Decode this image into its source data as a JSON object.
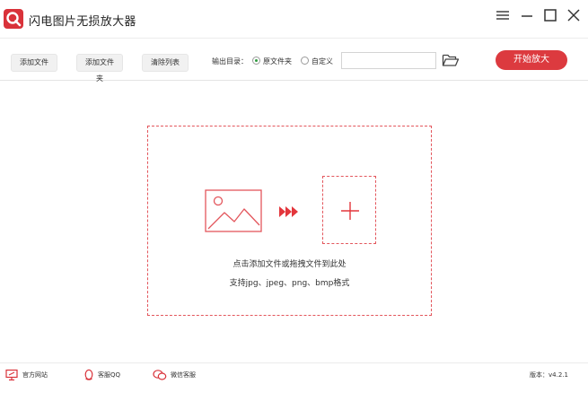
{
  "app": {
    "title": "闪电图片无损放大器"
  },
  "toolbar": {
    "add_file": "添加文件",
    "add_folder": "添加文件夹",
    "clear_list": "清除列表",
    "output_label": "输出目录：",
    "option_source": "原文件夹",
    "option_custom": "自定义",
    "selected_option": "原文件夹",
    "path_value": "",
    "start": "开始放大"
  },
  "drop": {
    "hint": "点击添加文件或拖拽文件到此处",
    "formats": "支持jpg、jpeg、png、bmp格式"
  },
  "footer": {
    "website": "官方网站",
    "qq": "客服QQ",
    "wechat": "微信客服",
    "version": "版本：v4.2.1"
  },
  "colors": {
    "accent": "#dc3a3f",
    "dashed": "#e3565c",
    "radio_checked": "#2f9a3f"
  },
  "icons": {
    "logo": "app-logo-icon",
    "menu": "menu-icon",
    "minimize": "minimize-icon",
    "maximize": "maximize-icon",
    "close": "close-icon",
    "folder": "folder-open-icon",
    "image": "image-icon",
    "arrows": "triple-arrow-icon",
    "add": "plus-icon",
    "website": "monitor-icon",
    "qq": "qq-penguin-icon",
    "wechat": "wechat-icon"
  }
}
